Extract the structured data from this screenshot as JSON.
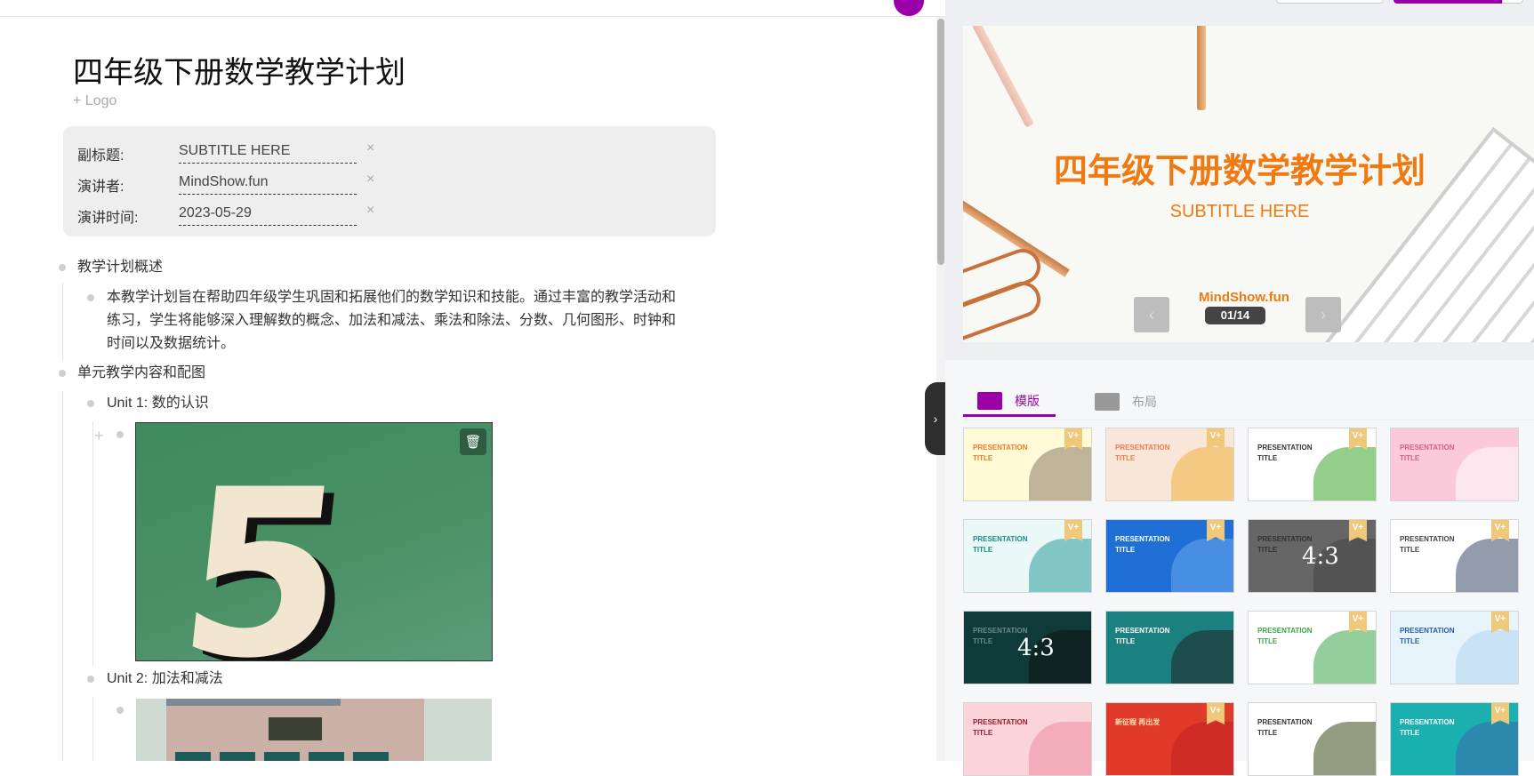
{
  "document": {
    "title": "四年级下册数学教学计划",
    "add_logo": "+ Logo",
    "meta": [
      {
        "label": "副标题:",
        "value": "SUBTITLE HERE"
      },
      {
        "label": "演讲者:",
        "value": "MindShow.fun"
      },
      {
        "label": "演讲时间:",
        "value": "2023-05-29"
      }
    ],
    "clear_icon": "×",
    "outline": {
      "section1": "教学计划概述",
      "para_lines": [
        "本教学计划旨在帮助四年级学生巩固和拓展他们的数学知识和技能。通过丰富的教学活动和",
        "练习，学生将能够深入理解数的概念、加法和减法、乘法和除法、分数、几何图形、时钟和",
        "时间以及数据统计。"
      ],
      "section2": "单元教学内容和配图",
      "unit1": "Unit 1: 数的认识",
      "unit2": "Unit 2: 加法和减法"
    }
  },
  "preview": {
    "title": "四年级下册数学教学计划",
    "subtitle": "SUBTITLE HERE",
    "author": "MindShow.fun",
    "page": "01/14",
    "prev": "‹",
    "next": "›"
  },
  "tabs": [
    {
      "label": "模版"
    },
    {
      "label": "布局"
    }
  ],
  "templates": [
    {
      "title": "PRESENTATION TITLE",
      "bg": "#fffbd6",
      "fg": "#f07a2c",
      "accent": "#8a7a6a",
      "vip": true
    },
    {
      "title": "PRESENTATION TITLE",
      "bg": "#f8e6d8",
      "fg": "#f07a50",
      "accent": "#f0b040",
      "vip": true
    },
    {
      "title": "PRESENTATION TITLE",
      "bg": "#ffffff",
      "fg": "#333333",
      "accent": "#3aa62a",
      "vip": true
    },
    {
      "title": "PRESENTATION TITLE",
      "bg": "#fbc9da",
      "fg": "#d0608a",
      "accent": "#ffffff",
      "vip": false
    },
    {
      "title": "PRESENTATION TITLE",
      "bg": "#eaf8f8",
      "fg": "#1a8a8a",
      "accent": "#2a9a9a",
      "vip": true
    },
    {
      "title": "PRESENTATION TITLE",
      "bg": "#1f6fd6",
      "fg": "#ffffff",
      "accent": "#6aaaf0",
      "vip": true
    },
    {
      "title": "PRESENTATION TITLE",
      "bg": "#666666",
      "fg": "#333333",
      "accent": "#444444",
      "vip": true,
      "ratio": "4:3"
    },
    {
      "title": "PRESENTATION TITLE",
      "bg": "#ffffff",
      "fg": "#444444",
      "accent": "#3a4a6a",
      "vip": true
    },
    {
      "title": "PRESENTATION TITLE",
      "bg": "#0f3a3a",
      "fg": "#6a8a8a",
      "accent": "#111111",
      "vip": false,
      "ratio": "4:3"
    },
    {
      "title": "PRESENTATION TITLE",
      "bg": "#1a8080",
      "fg": "#ffffff",
      "accent": "#222222",
      "vip": false
    },
    {
      "title": "PRESENTATION TITLE",
      "bg": "#ffffff",
      "fg": "#3aa64a",
      "accent": "#3aa64a",
      "vip": true
    },
    {
      "title": "PRESENTATION TITLE",
      "bg": "#e8f4fc",
      "fg": "#2a5aa0",
      "accent": "#b0d4f0",
      "vip": true
    },
    {
      "title": "PRESENTATION TITLE",
      "bg": "#fbd4da",
      "fg": "#9a1a30",
      "accent": "#f08aa0",
      "vip": false
    },
    {
      "title": "新征程 再出发",
      "bg": "#e23a2a",
      "fg": "#ffe0b0",
      "accent": "#c02020",
      "vip": true
    },
    {
      "title": "PRESENTATION TITLE",
      "bg": "#ffffff",
      "fg": "#333333",
      "accent": "#3a4a1a",
      "vip": false
    },
    {
      "title": "PRESENTATION TITLE",
      "bg": "#1ab0b0",
      "fg": "#ffffff",
      "accent": "#3a6ab0",
      "vip": true
    }
  ],
  "vip_badge": "V+",
  "colors": {
    "brand": "#9b00a8",
    "slide_accent": "#f07a12"
  }
}
